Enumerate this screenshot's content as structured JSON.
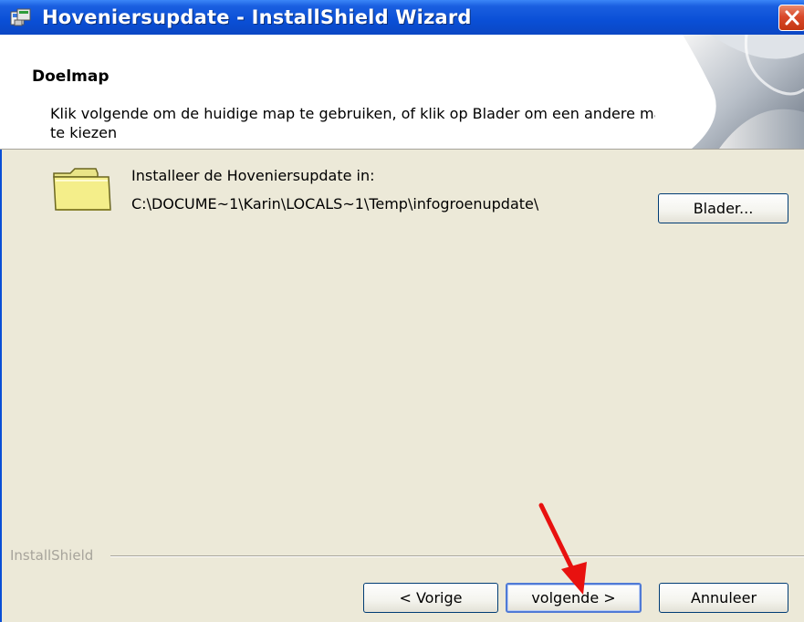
{
  "window": {
    "title": "Hoveniersupdate - InstallShield Wizard"
  },
  "header": {
    "title": "Doelmap",
    "subtitle": "Klik volgende om de huidige map te gebruiken, of klik op Blader om een andere map te kiezen"
  },
  "body": {
    "install_label": "Installeer de Hoveniersupdate in:",
    "install_path": "C:\\DOCUME~1\\Karin\\LOCALS~1\\Temp\\infogroenupdate\\",
    "browse_label": "Blader..."
  },
  "footer": {
    "brand": "InstallShield",
    "prev_label": "< Vorige",
    "next_label": "volgende >",
    "cancel_label": "Annuleer"
  },
  "icons": {
    "title_icon": "installer-icon",
    "close": "close-icon",
    "folder": "folder-icon",
    "annotation": "red-arrow-annotation"
  },
  "colors": {
    "titlebar": "#0a4fd6",
    "close_button": "#d9492a",
    "dialog_bg": "#ece9d8",
    "arrow": "#e8110f"
  }
}
